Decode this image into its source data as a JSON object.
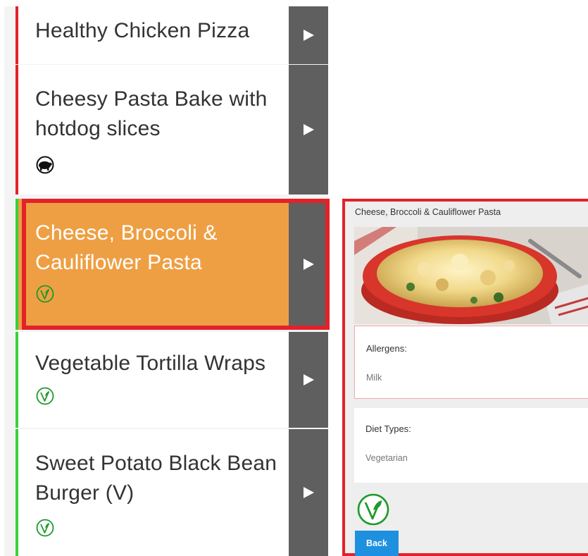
{
  "menu": {
    "items": [
      {
        "title": "Healthy Chicken Pizza",
        "status_color": "#e3212a",
        "diet_icon": null
      },
      {
        "title": "Cheesy Pasta Bake with hotdog slices",
        "status_color": "#e3212a",
        "diet_icon": "pig-icon"
      },
      {
        "title": "Cheese, Broccoli & Cauliflower Pasta",
        "status_color": "#3ad13a",
        "diet_icon": "vegetarian-icon",
        "selected": true
      },
      {
        "title": "Vegetable Tortilla Wraps",
        "status_color": "#3ad13a",
        "diet_icon": "vegetarian-icon"
      },
      {
        "title": "Sweet Potato Black Bean Burger (V)",
        "status_color": "#3ad13a",
        "diet_icon": "vegetarian-icon"
      }
    ],
    "open_icon": "play-arrow-icon",
    "selected_color": "#ee9f43",
    "highlight_color": "#e3212a"
  },
  "detail": {
    "title": "Cheese, Broccoli & Cauliflower Pasta",
    "allergens_label": "Allergens:",
    "allergens_value": "Milk",
    "diet_types_label": "Diet Types:",
    "diet_types_value": "Vegetarian",
    "diet_icon": "vegetarian-icon",
    "back_label": "Back",
    "back_color": "#1e90e0"
  }
}
